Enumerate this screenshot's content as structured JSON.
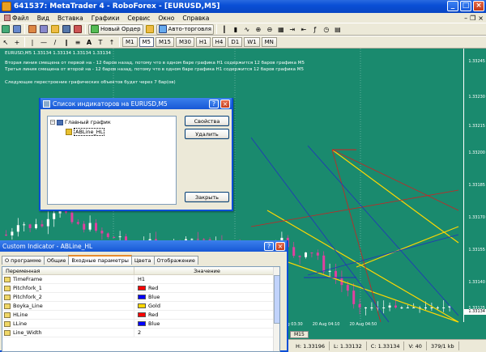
{
  "window": {
    "title": "641537: MetaTrader 4 - RoboForex - [EURUSD,M5]"
  },
  "menu": {
    "items": [
      "Файл",
      "Вид",
      "Вставка",
      "Графики",
      "Сервис",
      "Окно",
      "Справка"
    ]
  },
  "toolbar": {
    "new_order_label": "Новый Ордер",
    "auto_trading_label": "Авто-торговля",
    "timeframes": [
      "M1",
      "M5",
      "M15",
      "M30",
      "H1",
      "H4",
      "D1",
      "W1",
      "MN"
    ],
    "active_timeframe": "M5"
  },
  "chart": {
    "header": "EURUSD,M5  1.33134 1.33134 1.33134 1.33134",
    "messages": [
      "Вторая линия смещена от первой на - 12 баров назад, потому что в одном баре графика H1 содержится 12 баров графика M5",
      "Третья линия смещена от второй на - 12 баров назад, потому что в одном баре графика H1 содержится 12 баров графика M5",
      "Следующее перестроение графических объектов будет через 7 бар(ов)"
    ],
    "price_labels": [
      "1.33245",
      "1.33230",
      "1.33215",
      "1.33200",
      "1.33185",
      "1.33170",
      "1.33155",
      "1.33140",
      "1.33125"
    ],
    "current_price": "1.33134",
    "time_labels": [
      "20 Aug 03:30",
      "20 Aug 04:10",
      "20 Aug 04:50"
    ],
    "tab_label": "M15",
    "colors": {
      "background": "#1a8a6e",
      "bull": "#ffffff",
      "bear": "#e040a0",
      "line_red": "#cc2222",
      "line_blue": "#2233bb",
      "line_gold": "#ffd700"
    }
  },
  "indicator_list_dialog": {
    "title": "Список индикаторов на EURUSD,M5",
    "tree_root": "Главный график",
    "tree_child": "ABLine_HL",
    "buttons": {
      "properties": "Свойства",
      "delete": "Удалить",
      "close": "Закрыть"
    }
  },
  "custom_indicator_dialog": {
    "title": "Custom Indicator - ABLine_HL",
    "tabs": [
      "О программе",
      "Общие",
      "Входные параметры",
      "Цвета",
      "Отображение"
    ],
    "active_tab": "Входные параметры",
    "columns": [
      "Переменная",
      "Значение"
    ],
    "rows": [
      {
        "name": "TimeFrame",
        "value": "H1",
        "color": null
      },
      {
        "name": "Pitchfork_1",
        "value": "Red",
        "color": "#ff0000"
      },
      {
        "name": "Pitchfork_2",
        "value": "Blue",
        "color": "#0000ff"
      },
      {
        "name": "Boyka_Line",
        "value": "Gold",
        "color": "#ffd700"
      },
      {
        "name": "HLine",
        "value": "Red",
        "color": "#ff0000"
      },
      {
        "name": "LLine",
        "value": "Blue",
        "color": "#0000ff"
      },
      {
        "name": "Line_Width",
        "value": "2",
        "color": null
      }
    ]
  },
  "statusbar": {
    "cells": [
      "H: 1.33196",
      "L: 1.33132",
      "C: 1.33134",
      "V: 40",
      "379/1 kb"
    ]
  }
}
